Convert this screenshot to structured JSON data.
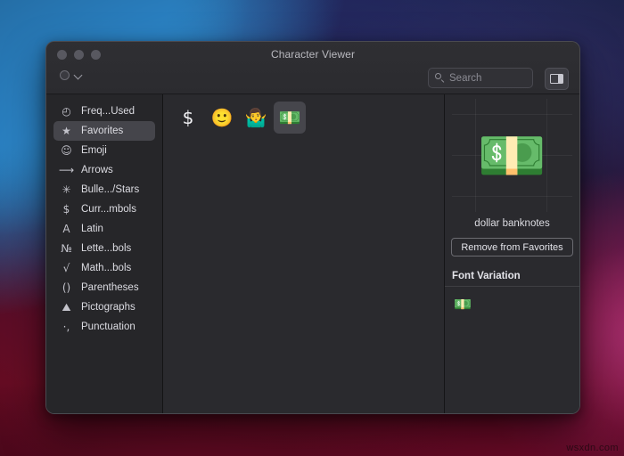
{
  "window": {
    "title": "Character Viewer",
    "traffic_lights": [
      "close",
      "minimize",
      "zoom"
    ]
  },
  "toolbar": {
    "action_menu_icon": "gear-chevron-icon",
    "search": {
      "placeholder": "Search",
      "value": "",
      "icon": "search-icon"
    },
    "panel_toggle_icon": "sidebar-panel-icon"
  },
  "sidebar": {
    "items": [
      {
        "label": "Freq...Used",
        "icon": "clock-icon",
        "glyph": "◴",
        "selected": false
      },
      {
        "label": "Favorites",
        "icon": "star-icon",
        "glyph": "★",
        "selected": true
      },
      {
        "label": "Emoji",
        "icon": "smiley-icon",
        "glyph": "☺",
        "selected": false
      },
      {
        "label": "Arrows",
        "icon": "arrow-right-icon",
        "glyph": "⟶",
        "selected": false
      },
      {
        "label": "Bulle.../Stars",
        "icon": "asterisk-icon",
        "glyph": "✳",
        "selected": false
      },
      {
        "label": "Curr...mbols",
        "icon": "dollar-sign-icon",
        "glyph": "$",
        "selected": false
      },
      {
        "label": "Latin",
        "icon": "letter-a-icon",
        "glyph": "A",
        "selected": false
      },
      {
        "label": "Lette...bols",
        "icon": "numero-icon",
        "glyph": "№",
        "selected": false
      },
      {
        "label": "Math...bols",
        "icon": "square-root-icon",
        "glyph": "√",
        "selected": false
      },
      {
        "label": "Parentheses",
        "icon": "parentheses-icon",
        "glyph": "()",
        "selected": false
      },
      {
        "label": "Pictographs",
        "icon": "pictograph-icon",
        "glyph": "⛰",
        "selected": false
      },
      {
        "label": "Punctuation",
        "icon": "punctuation-icon",
        "glyph": "·,",
        "selected": false
      }
    ]
  },
  "grid": {
    "characters": [
      {
        "glyph": "$",
        "name": "dollar sign",
        "selected": false
      },
      {
        "glyph": "🙂",
        "name": "slightly smiling face",
        "selected": false
      },
      {
        "glyph": "🤷‍♂️",
        "name": "man shrugging",
        "selected": false
      },
      {
        "glyph": "💵",
        "name": "dollar banknotes",
        "selected": true
      }
    ]
  },
  "detail": {
    "preview_glyph": "💵",
    "character_name": "dollar banknotes",
    "favorite_button_label": "Remove from Favorites",
    "font_variation_heading": "Font Variation",
    "variations": [
      {
        "glyph": "💵",
        "name": "dollar banknotes"
      }
    ]
  },
  "desktop": {
    "watermark": "wsxdn.com"
  },
  "colors": {
    "window_bg": "#2a2a2e",
    "sidebar_bg": "#262629",
    "titlebar_bg": "#2f2f33",
    "selection": "#45454b",
    "text_primary": "#dcdce2",
    "text_secondary": "#8b8b93"
  }
}
